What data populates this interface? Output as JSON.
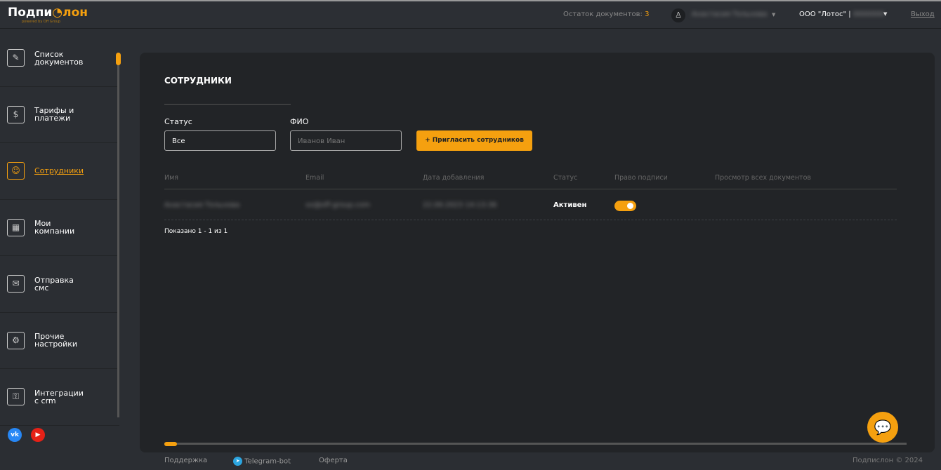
{
  "header": {
    "logo_a": "Подпи",
    "logo_b": "лон",
    "logo_sub": "powered by Off Group",
    "docs_label": "Остаток документов:",
    "docs_count": "3",
    "user_name": "Анастасия Тельнова",
    "org": "ООО \"Лотос\" |",
    "org_inn": "0000000",
    "logout": "Выход"
  },
  "sidebar": {
    "items": [
      {
        "label": "Список документов",
        "icon": "document-sign-icon"
      },
      {
        "label": "Тарифы и платежи",
        "icon": "tariff-icon"
      },
      {
        "label": "Сотрудники",
        "icon": "employees-icon",
        "active": true
      },
      {
        "label": "Мои компании",
        "icon": "companies-icon"
      },
      {
        "label": "Отправка смс",
        "icon": "sms-icon"
      },
      {
        "label": "Прочие настройки",
        "icon": "settings-icon"
      },
      {
        "label": "Интеграции с crm",
        "icon": "crm-icon"
      }
    ],
    "social": {
      "vk": "vk",
      "yt": "▶"
    }
  },
  "main": {
    "title": "СОТРУДНИКИ",
    "status_label": "Статус",
    "status_value": "Все",
    "fio_label": "ФИО",
    "fio_placeholder": "Иванов Иван",
    "invite": "+ Пригласить сотрудников",
    "columns": [
      "Имя",
      "Email",
      "Дата добавления",
      "Статус",
      "Право подписи",
      "Просмотр всех документов"
    ],
    "rows": [
      {
        "name": "Анастасия Тельнова",
        "email": "xx@off-group.com",
        "date": "22.09.2023 14:13:36",
        "status": "Активен",
        "sign_right": true
      }
    ],
    "shown": "Показано 1 - 1 из 1"
  },
  "footer": {
    "support": "Поддержка",
    "telegram": "Telegram-bot",
    "offer": "Оферта",
    "copyright": "Подпислон © 2024"
  },
  "colors": {
    "accent": "#f5a00f",
    "bg": "#2b2e33",
    "panel": "#222427"
  }
}
